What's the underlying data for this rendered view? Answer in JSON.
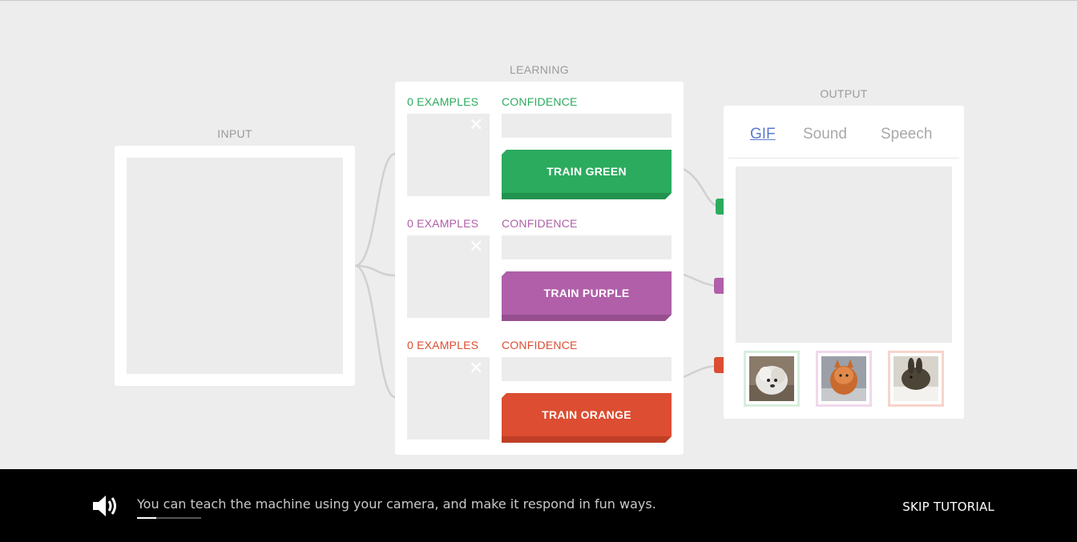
{
  "sections": {
    "input": "INPUT",
    "learning": "LEARNING",
    "output": "OUTPUT"
  },
  "classes": [
    {
      "examples": "0 EXAMPLES",
      "confidence": "CONFIDENCE",
      "train_label": "TRAIN GREEN",
      "color": "#2bab5e",
      "shade": "#22934f",
      "clear_icon": "close-icon",
      "confidence_level": 0
    },
    {
      "examples": "0 EXAMPLES",
      "confidence": "CONFIDENCE",
      "train_label": "TRAIN PURPLE",
      "color": "#b05fa8",
      "shade": "#964e8f",
      "clear_icon": "close-icon",
      "confidence_level": 0
    },
    {
      "examples": "0 EXAMPLES",
      "confidence": "CONFIDENCE",
      "train_label": "TRAIN ORANGE",
      "color": "#dc4d31",
      "shade": "#bf3e25",
      "clear_icon": "close-icon",
      "confidence_level": 0
    }
  ],
  "output": {
    "tabs": [
      {
        "label": "GIF",
        "active": true
      },
      {
        "label": "Sound",
        "active": false
      },
      {
        "label": "Speech",
        "active": false
      }
    ],
    "thumbnails": [
      {
        "name": "white-dog-thumbnail",
        "border": "#d7eedd"
      },
      {
        "name": "orange-cat-thumbnail",
        "border": "#f1d8ec"
      },
      {
        "name": "rabbit-thumbnail",
        "border": "#f6d5cc"
      }
    ]
  },
  "tutorial": {
    "caption": "You can teach the machine using your camera, and make it respond in fun ways.",
    "skip_label": "SKIP TUTORIAL",
    "progress": 0.3,
    "speaker_icon": "speaker-icon"
  }
}
